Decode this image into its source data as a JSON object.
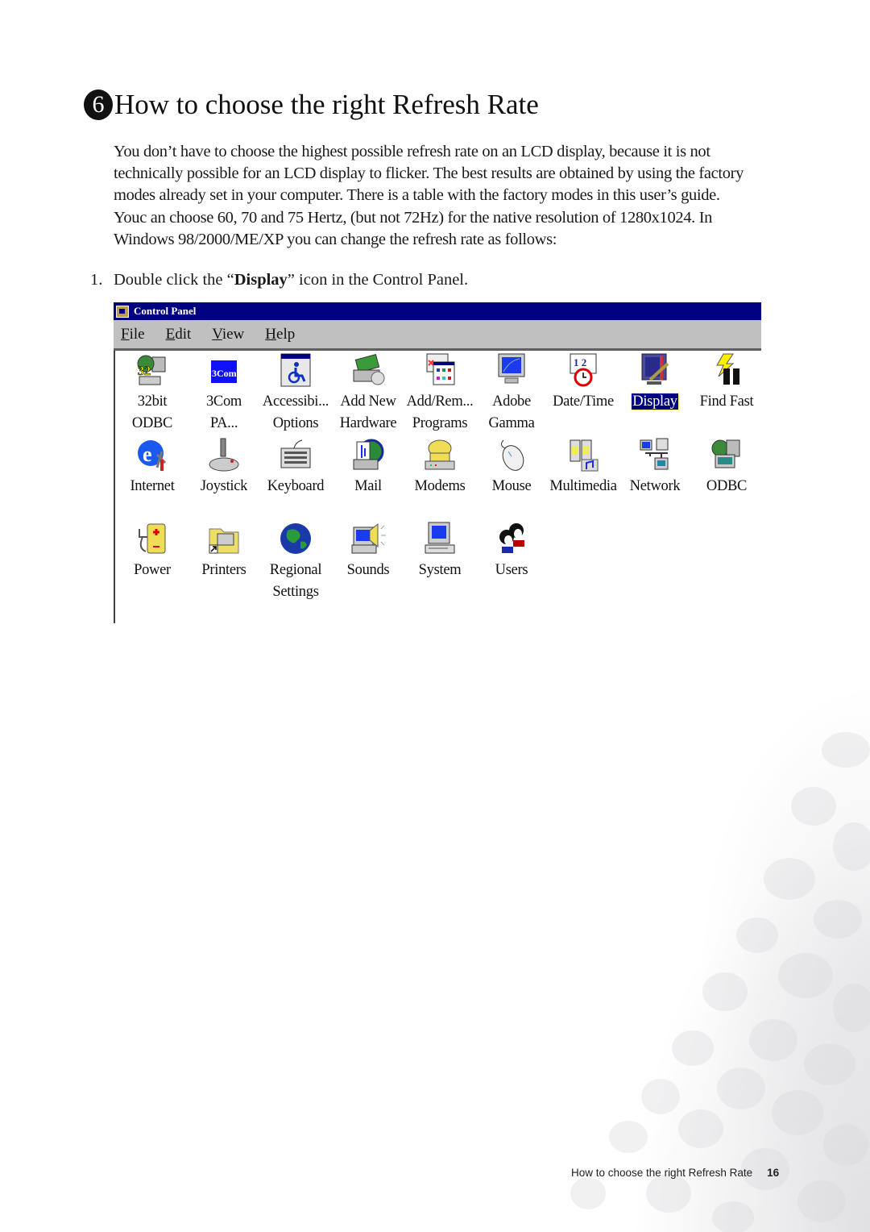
{
  "heading": {
    "number": "6",
    "title": "How to choose the right Refresh Rate"
  },
  "paragraph": {
    "lines": [
      "You don’t have to choose the highest possible refresh rate on an LCD display, because it is not",
      "technically possible for an LCD display to flicker. The best results are obtained by using the factory",
      "modes already set in your computer. There is a table with the factory modes in this user’s guide.",
      "Youc an choose 60, 70 and 75 Hertz, (but not 72Hz) for the native resolution of 1280x1024. In",
      "Windows 98/2000/ME/XP you can change the refresh rate as follows:"
    ]
  },
  "step": {
    "number": "1.",
    "before": "Double click the “",
    "bold": "Display",
    "after": "” icon in the Control Panel."
  },
  "control_panel": {
    "title": "Control Panel",
    "menu": [
      {
        "accel": "F",
        "rest": "ile"
      },
      {
        "accel": "E",
        "rest": "dit"
      },
      {
        "accel": "V",
        "rest": "iew"
      },
      {
        "accel": "H",
        "rest": "elp"
      }
    ],
    "items": [
      {
        "line1": "32bit",
        "line2": "ODBC",
        "icon": "odbc-32bit-icon"
      },
      {
        "line1": "3Com",
        "line2": "PA...",
        "icon": "3com-icon"
      },
      {
        "line1": "Accessibi...",
        "line2": "Options",
        "icon": "accessibility-icon"
      },
      {
        "line1": "Add New",
        "line2": "Hardware",
        "icon": "add-hardware-icon"
      },
      {
        "line1": "Add/Rem...",
        "line2": "Programs",
        "icon": "add-remove-programs-icon"
      },
      {
        "line1": "Adobe",
        "line2": "Gamma",
        "icon": "adobe-gamma-icon"
      },
      {
        "line1": "Date/Time",
        "line2": "",
        "icon": "date-time-icon"
      },
      {
        "line1": "Display",
        "line2": "",
        "icon": "display-icon",
        "selected": true
      },
      {
        "line1": "Find Fast",
        "line2": "",
        "icon": "find-fast-icon"
      },
      {
        "line1": "Internet",
        "line2": "",
        "icon": "internet-icon"
      },
      {
        "line1": "Joystick",
        "line2": "",
        "icon": "joystick-icon"
      },
      {
        "line1": "Keyboard",
        "line2": "",
        "icon": "keyboard-icon"
      },
      {
        "line1": "Mail",
        "line2": "",
        "icon": "mail-icon"
      },
      {
        "line1": "Modems",
        "line2": "",
        "icon": "modem-icon"
      },
      {
        "line1": "Mouse",
        "line2": "",
        "icon": "mouse-icon"
      },
      {
        "line1": "Multimedia",
        "line2": "",
        "icon": "multimedia-icon"
      },
      {
        "line1": "Network",
        "line2": "",
        "icon": "network-icon"
      },
      {
        "line1": "ODBC",
        "line2": "",
        "icon": "odbc-icon"
      },
      {
        "line1": "Power",
        "line2": "",
        "icon": "power-icon"
      },
      {
        "line1": "Printers",
        "line2": "",
        "icon": "printers-icon"
      },
      {
        "line1": "Regional",
        "line2": "Settings",
        "icon": "regional-settings-icon"
      },
      {
        "line1": "Sounds",
        "line2": "",
        "icon": "sounds-icon"
      },
      {
        "line1": "System",
        "line2": "",
        "icon": "system-icon"
      },
      {
        "line1": "Users",
        "line2": "",
        "icon": "users-icon"
      }
    ]
  },
  "footer": {
    "section": "How to choose the right Refresh Rate",
    "page": "16"
  }
}
